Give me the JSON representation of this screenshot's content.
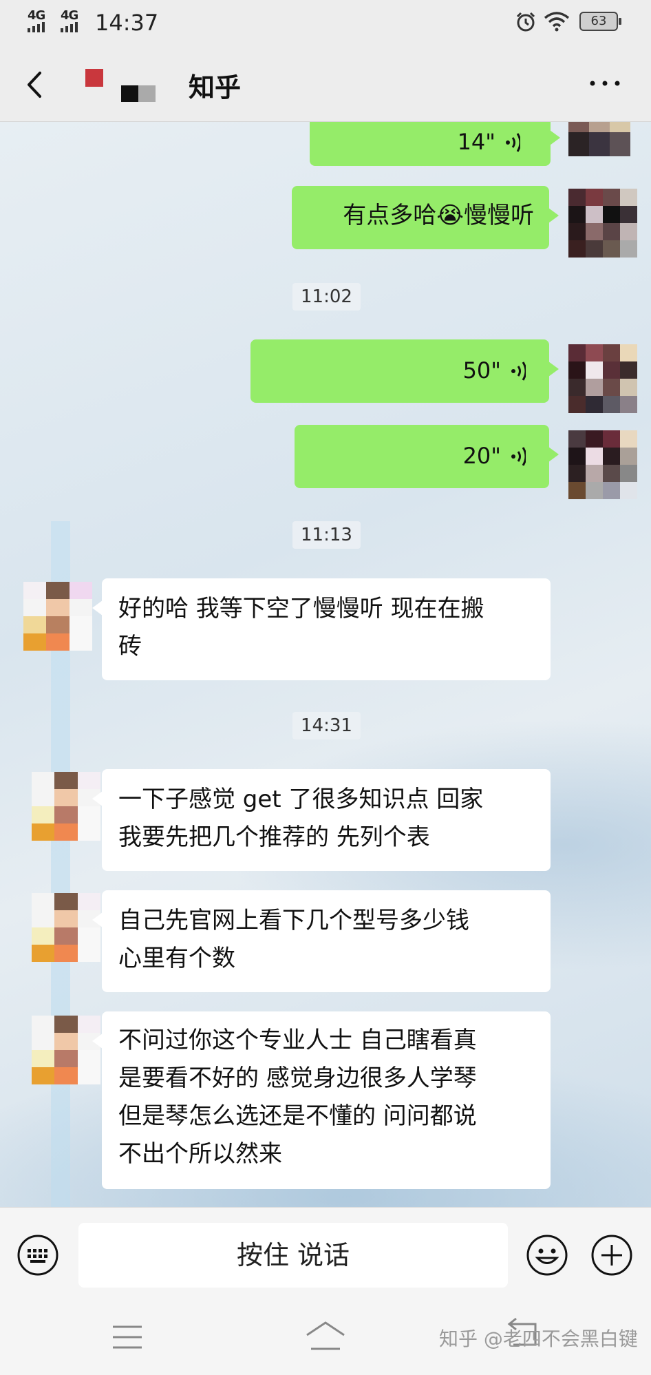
{
  "status_bar": {
    "network1": "4G",
    "network2": "4G",
    "time": "14:37",
    "battery": "63"
  },
  "header": {
    "title": "知乎"
  },
  "messages": {
    "m1_voice": "14\"",
    "m2_text": "有点多哈😭慢慢听",
    "ts1": "11:02",
    "m3_voice": "50\"",
    "m4_voice": "20\"",
    "ts2": "11:13",
    "m5_line1": "好的哈 我等下空了慢慢听 现在在搬",
    "m5_line2": "砖",
    "ts3": "14:31",
    "m6_line1": "一下子感觉 get 了很多知识点  回家",
    "m6_line2": "我要先把几个推荐的 先列个表",
    "m7_line1": "自己先官网上看下几个型号多少钱",
    "m7_line2": "心里有个数",
    "m8_line1": "不问过你这个专业人士 自己瞎看真",
    "m8_line2": "是要看不好的 感觉身边很多人学琴",
    "m8_line3": "但是琴怎么选还是不懂的 问问都说",
    "m8_line4": "不出个所以然来"
  },
  "input_bar": {
    "talk_label": "按住 说话"
  },
  "nav_bar": {
    "watermark": "知乎 @老四不会黑白键"
  },
  "colors": {
    "my_bubble": "#95ec69",
    "other_bubble": "#ffffff",
    "bar_bg": "#ededed"
  },
  "icons": [
    "back-icon",
    "more-icon",
    "voice-wave-icon",
    "keyboard-icon",
    "emoji-icon",
    "plus-icon",
    "menu-icon",
    "home-icon",
    "back-nav-icon",
    "alarm-icon",
    "wifi-icon"
  ]
}
